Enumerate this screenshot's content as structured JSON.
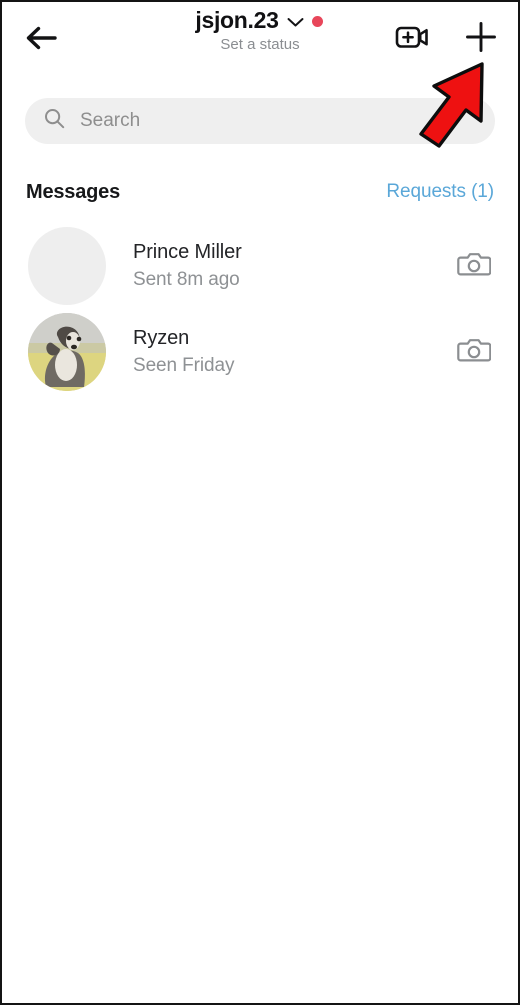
{
  "app": {
    "screen_name": "Instagram Direct Messages"
  },
  "header": {
    "back_icon": "arrow-left-icon",
    "username": "jsjon.23",
    "chevron_icon": "chevron-down-icon",
    "status_dot_icon": "red-status-dot",
    "status_dot_color": "#e8465a",
    "set_status_label": "Set a status",
    "video_call_icon": "video-call-add-icon",
    "new_message_icon": "plus-icon"
  },
  "search": {
    "icon": "search-icon",
    "placeholder": "Search",
    "value": "",
    "background_color": "#efefef"
  },
  "section": {
    "title": "Messages",
    "requests_label": "Requests (1)",
    "requests_color": "#5aa7d8"
  },
  "chats": [
    {
      "name": "Prince Miller",
      "status": "Sent 8m ago",
      "avatar_type": "blank",
      "avatar_color": "#eeeeee",
      "action_icon": "camera-icon"
    },
    {
      "name": "Ryzen",
      "status": "Seen Friday",
      "avatar_type": "photo",
      "avatar_color": "#d9d27c",
      "action_icon": "camera-icon"
    }
  ],
  "annotation": {
    "arrow_icon": "red-arrow-pointing-up-right",
    "arrow_fill": "#ee1111",
    "arrow_stroke": "#0d0d0d",
    "points_to": "plus-icon"
  }
}
